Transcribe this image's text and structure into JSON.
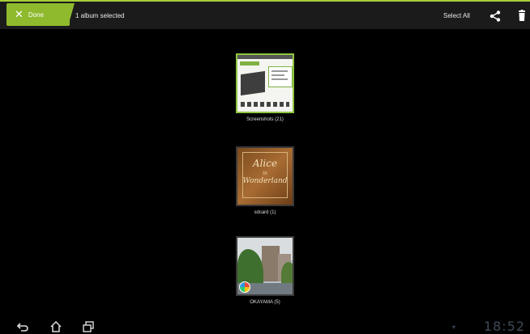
{
  "action_bar": {
    "done_label": "Done",
    "selection_text": "1 album selected",
    "select_all_label": "Select All",
    "icons": [
      "close-icon",
      "share-icon",
      "trash-icon"
    ],
    "accent_color": "#8fba2e"
  },
  "albums": [
    {
      "label": "Screenshots (21)",
      "selected": true
    },
    {
      "label": "sdcard (1)",
      "selected": false,
      "cover_title": "Alice",
      "cover_in": "in",
      "cover_subtitle": "Wonderland"
    },
    {
      "label": "OKAYAMA (5)",
      "selected": false
    }
  ],
  "system_bar": {
    "icons": [
      "back-icon",
      "home-icon",
      "recent-apps-icon",
      "wifi-icon"
    ],
    "clock": "18:52"
  }
}
